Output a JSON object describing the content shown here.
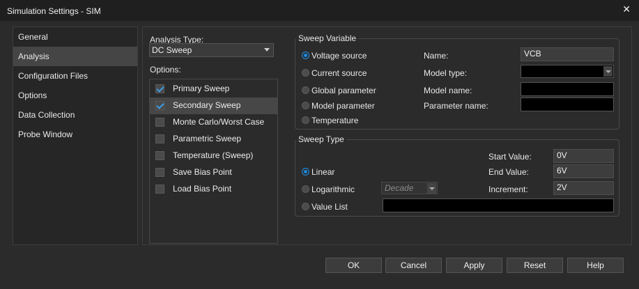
{
  "window": {
    "title": "Simulation Settings - SIM",
    "close_glyph": "✕"
  },
  "nav": {
    "items": [
      "General",
      "Analysis",
      "Configuration Files",
      "Options",
      "Data Collection",
      "Probe Window"
    ],
    "active": "Analysis"
  },
  "analysis": {
    "type_label": "Analysis Type:",
    "type_value": "DC Sweep",
    "options_label": "Options:"
  },
  "options": [
    {
      "label": "Primary Sweep",
      "checked": true
    },
    {
      "label": "Secondary Sweep",
      "checked": true
    },
    {
      "label": "Monte Carlo/Worst Case",
      "checked": false
    },
    {
      "label": "Parametric Sweep",
      "checked": false
    },
    {
      "label": "Temperature (Sweep)",
      "checked": false
    },
    {
      "label": "Save Bias Point",
      "checked": false
    },
    {
      "label": "Load Bias Point",
      "checked": false
    }
  ],
  "sweep_variable": {
    "title": "Sweep Variable",
    "radios": [
      "Voltage source",
      "Current source",
      "Global parameter",
      "Model parameter",
      "Temperature"
    ],
    "selected": "Voltage source",
    "name_label": "Name:",
    "name_value": "VCB",
    "model_type_label": "Model type:",
    "model_type_value": "",
    "model_name_label": "Model name:",
    "model_name_value": "",
    "param_name_label": "Parameter name:",
    "param_name_value": ""
  },
  "sweep_type": {
    "title": "Sweep Type",
    "radios": [
      "Linear",
      "Logarithmic",
      "Value List"
    ],
    "selected": "Linear",
    "log_scale_value": "Decade",
    "value_list_value": "",
    "start_label": "Start Value:",
    "start_value": "0V",
    "end_label": "End Value:",
    "end_value": "6V",
    "inc_label": "Increment:",
    "inc_value": "2V"
  },
  "buttons": {
    "ok": "OK",
    "cancel": "Cancel",
    "apply": "Apply",
    "reset": "Reset",
    "help": "Help"
  },
  "colors": {
    "accent": "#1e8ae0",
    "background": "#2b2b2b",
    "titlebar": "#1f1f1f"
  }
}
